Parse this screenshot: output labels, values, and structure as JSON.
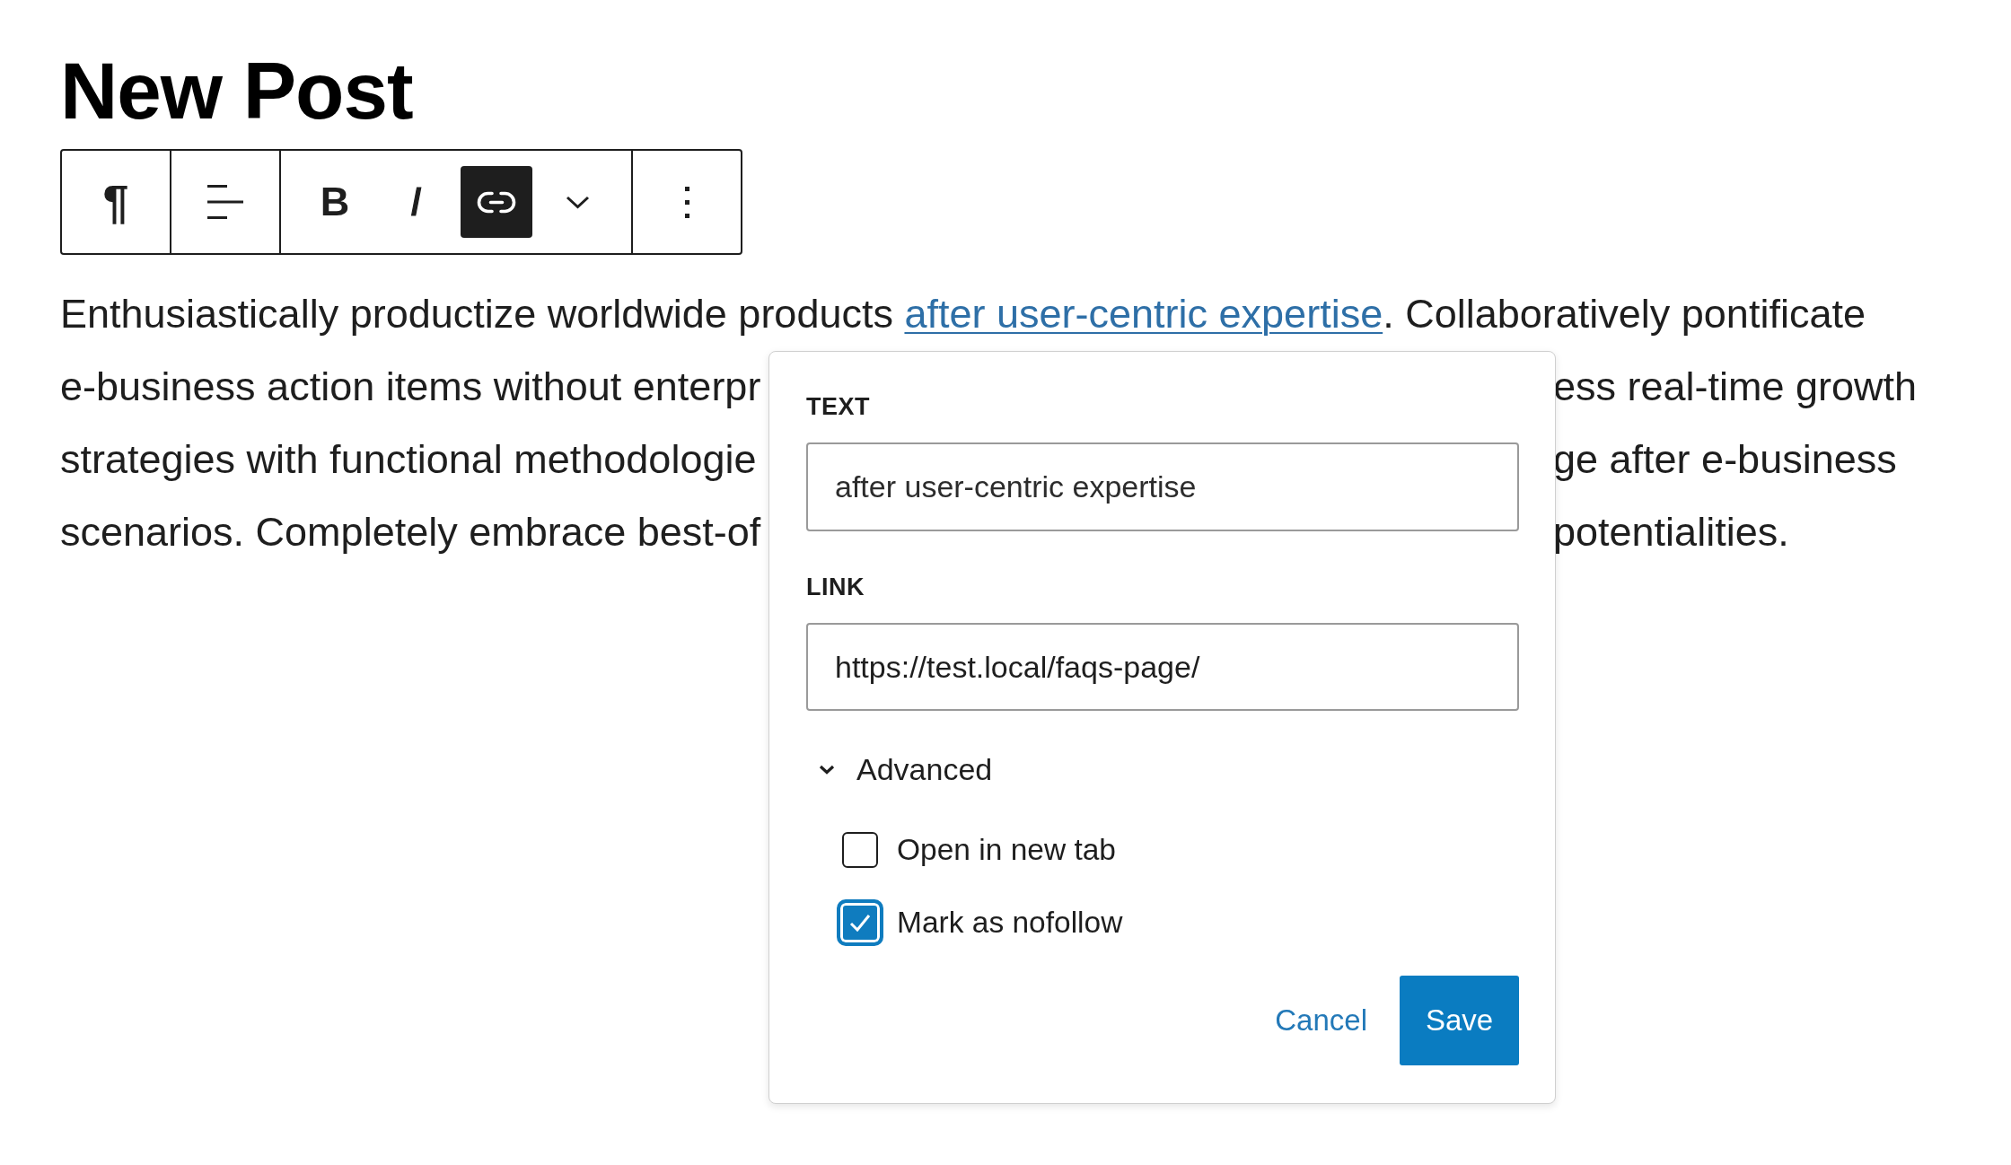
{
  "title": "New Post",
  "toolbar": {
    "groups": [
      {
        "items": [
          {
            "kind": "paragraph",
            "label": "¶",
            "pressed": false
          }
        ]
      },
      {
        "items": [
          {
            "kind": "align",
            "pressed": false
          }
        ]
      },
      {
        "items": [
          {
            "kind": "bold",
            "label": "B",
            "pressed": false
          },
          {
            "kind": "italic",
            "label": "I",
            "pressed": false
          },
          {
            "kind": "link",
            "pressed": true
          },
          {
            "kind": "dropdown",
            "pressed": false
          }
        ]
      },
      {
        "items": [
          {
            "kind": "options",
            "pressed": false
          }
        ]
      }
    ]
  },
  "paragraph": {
    "first_line": {
      "before": "Enthusiastically productize worldwide products ",
      "link": "after user-centric expertise",
      "after": ". Collaboratively pontificate"
    },
    "covered_lines": [
      {
        "left": "e-business action items without enterpr",
        "right": "ess real-time growth"
      },
      {
        "left": "strategies with functional methodologie",
        "right": "ge after e-business"
      },
      {
        "left": "scenarios. Completely embrace best-of",
        "right": "potentialities."
      }
    ]
  },
  "link_popover": {
    "text_field": {
      "label": "TEXT",
      "value": "after user-centric expertise"
    },
    "link_field": {
      "label": "LINK",
      "value": "https://test.local/faqs-page/"
    },
    "advanced": {
      "label": "Advanced",
      "expanded": true,
      "options": [
        {
          "label": "Open in new tab",
          "checked": false,
          "focused": false
        },
        {
          "label": "Mark as nofollow",
          "checked": true,
          "focused": true
        }
      ]
    },
    "buttons": [
      {
        "kind": "secondary",
        "label": "Cancel"
      },
      {
        "kind": "primary",
        "label": "Save"
      }
    ]
  }
}
